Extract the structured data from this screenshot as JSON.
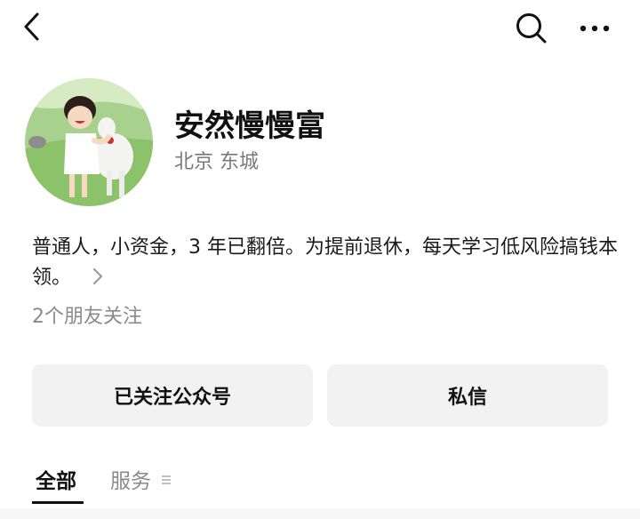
{
  "header": {
    "back_icon": "chevron-left-icon",
    "search_icon": "search-icon",
    "more_icon": "more-horizontal-icon"
  },
  "profile": {
    "avatar_description_icon": "cartoon-girl-with-goat-avatar",
    "name": "安然慢慢富",
    "location": "北京 东城",
    "bio": "普通人，小资金，3 年已翻倍。为提前退休，每天学习低风险搞钱本领。",
    "friends_following": "2个朋友关注"
  },
  "actions": {
    "followed_label": "已关注公众号",
    "message_label": "私信"
  },
  "tabs": [
    {
      "label": "全部",
      "active": true
    },
    {
      "label": "服务",
      "active": false
    }
  ],
  "colors": {
    "button_bg": "#f2f2f2",
    "secondary_text": "#7a7a7a",
    "primary_text": "#111111"
  }
}
